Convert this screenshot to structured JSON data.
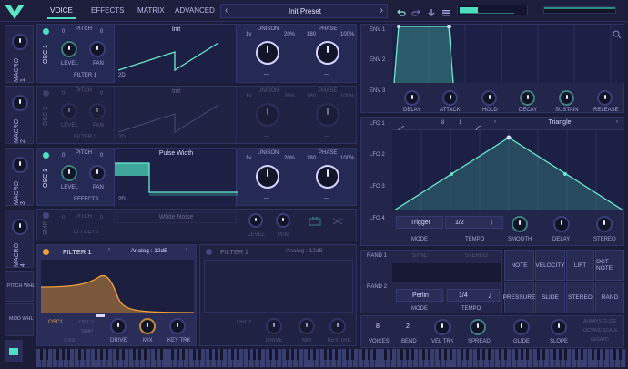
{
  "topnav": {
    "tabs": [
      "VOICE",
      "EFFECTS",
      "MATRIX",
      "ADVANCED"
    ],
    "preset": "Init Preset",
    "prev": "‹",
    "next": "›"
  },
  "macros": [
    "MACRO 1",
    "MACRO 2",
    "MACRO 3",
    "MACRO 4"
  ],
  "side_buttons": [
    "PITCH WHL",
    "MOD WHL"
  ],
  "osc1": {
    "name": "OSC 1",
    "pitch": "PITCH",
    "p1": "0",
    "p2": "0",
    "level": "LEVEL",
    "pan": "PAN",
    "route": "FILTER 1",
    "wave": "Init",
    "dim": "2D",
    "unison": "UNISON",
    "uv1": "1v",
    "uv2": "20%",
    "phase": "PHASE",
    "pv1": "180",
    "pv2": "100%",
    "dash": "—"
  },
  "osc2": {
    "name": "OSC 2",
    "pitch": "PITCH",
    "p1": "0",
    "p2": "0",
    "level": "LEVEL",
    "pan": "PAN",
    "route": "FILTER 2",
    "wave": "Init",
    "dim": "2D",
    "unison": "UNISON",
    "uv1": "1v",
    "uv2": "20%",
    "phase": "PHASE",
    "pv1": "180",
    "pv2": "100%",
    "dash": "—"
  },
  "osc3": {
    "name": "OSC 3",
    "pitch": "PITCH",
    "p1": "0",
    "p2": "0",
    "level": "LEVEL",
    "pan": "PAN",
    "route": "EFFECTS",
    "wave": "Pulse Width",
    "dim": "2D",
    "unison": "UNISON",
    "uv1": "1v",
    "uv2": "20%",
    "phase": "PHASE",
    "pv1": "180",
    "pv2": "100%",
    "dash": "—"
  },
  "smp": {
    "name": "SMP",
    "pitch": "PITCH",
    "p1": "0",
    "p2": "0",
    "route": "EFFECTS",
    "wave": "White Noise",
    "level": "LEVEL",
    "pan": "PAN"
  },
  "filter1": {
    "name": "FILTER 1",
    "type": "Analog : 12dB",
    "src1": "OSC1",
    "src2": "OSC2",
    "src3": "SMP",
    "fx": "FX3",
    "drive": "DRIVE",
    "mix": "MIX",
    "keytrk": "KEY TRK"
  },
  "filter2": {
    "name": "FILTER 2",
    "type": "Analog : 12dB",
    "src2": "OSC2",
    "drive": "DRIVE",
    "mix": "MIX",
    "keytrk": "KEY TRK"
  },
  "env": {
    "labels": [
      "ENV 1",
      "ENV 2",
      "ENV 3"
    ],
    "knobs": [
      "DELAY",
      "ATTACK",
      "HOLD",
      "DECAY",
      "SUSTAIN",
      "RELEASE"
    ]
  },
  "lfo": {
    "labels": [
      "LFO 1",
      "LFO 2",
      "LFO 3",
      "LFO 4"
    ],
    "shape": "Triangle",
    "v1": "8",
    "v2": "1",
    "mode_val": "Trigger",
    "mode": "MODE",
    "tempo_val": "1/2",
    "tempo": "TEMPO",
    "smooth": "SMOOTH",
    "delay": "DELAY",
    "stereo": "STEREO"
  },
  "rand": {
    "labels": [
      "RAND 1",
      "RAND 2"
    ],
    "sync": "SYNC",
    "stereo_btn": "STEREO",
    "mode_val": "Perlin",
    "mode": "MODE",
    "tempo_val": "1/4",
    "tempo": "TEMPO"
  },
  "matrix_buttons": [
    "NOTE",
    "VELOCITY",
    "LIFT",
    "OCT NOTE",
    "PRESSURE",
    "SLIDE",
    "STEREO",
    "RAND"
  ],
  "voice": {
    "voices_val": "8",
    "voices": "VOICES",
    "bend_val": "2",
    "bend": "BEND",
    "veltrk": "VEL TRK",
    "spread": "SPREAD",
    "glide": "GLIDE",
    "slope": "SLOPE",
    "opt1": "ALWAYS GLIDE",
    "opt2": "OCTAVE SCALE",
    "opt3": "LEGATO"
  },
  "colors": {
    "accent": "#4de0c0",
    "orange": "#f0a03a",
    "bg": "#1a1c38"
  }
}
